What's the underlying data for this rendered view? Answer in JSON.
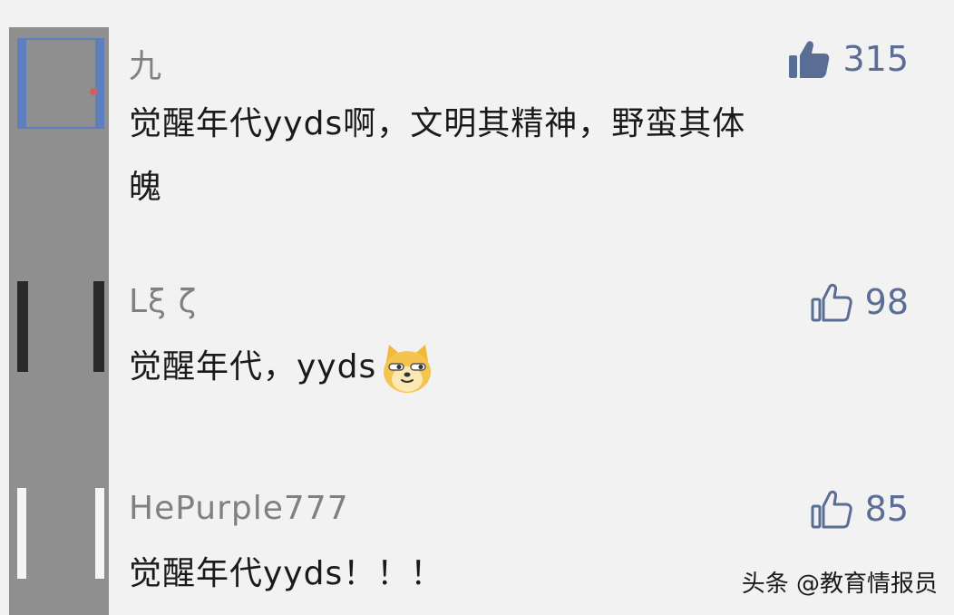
{
  "comments": [
    {
      "username": "九",
      "text": "觉醒年代yyds啊，文明其精神，野蛮其体魄",
      "text_line1": "觉醒年代yyds啊，文明其精神，野蛮其体",
      "text_line2": "魄",
      "likes": "315",
      "liked": true
    },
    {
      "username": "Lξ ζ",
      "text": "觉醒年代，yyds",
      "likes": "98",
      "liked": false
    },
    {
      "username": "HePurple777",
      "text": "觉醒年代yyds！！！",
      "likes": "85",
      "liked": false
    }
  ],
  "watermark": "头条 @教育情报员",
  "colors": {
    "like_accent": "#5a6d94",
    "username": "#808080",
    "background": "#f2f2f2"
  },
  "icons": {
    "like_filled": "thumbs-up-filled-icon",
    "like_outline": "thumbs-up-outline-icon",
    "emoji": "smirking-dog-emoji"
  }
}
